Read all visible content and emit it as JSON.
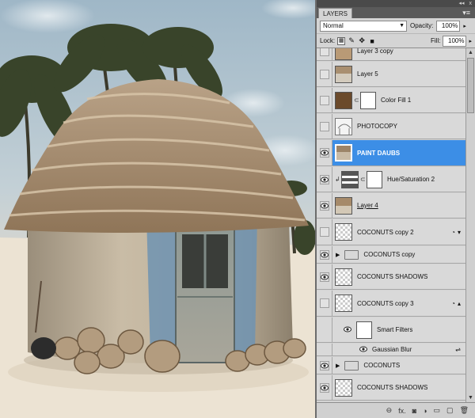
{
  "panel": {
    "title": "LAYERS",
    "window_controls": [
      "◂◂",
      "x"
    ],
    "menu_icon": "panel-menu-icon",
    "blend_mode": "Normal",
    "opacity_label": "Opacity:",
    "opacity_value": "100%",
    "lock_label": "Lock:",
    "fill_label": "Fill:",
    "fill_value": "100%"
  },
  "layers": [
    {
      "name": "Layer 3 copy",
      "visible": false,
      "kind": "image"
    },
    {
      "name": "Layer 5",
      "visible": false,
      "kind": "image"
    },
    {
      "name": "Color Fill 1",
      "visible": false,
      "kind": "fill",
      "color": "#6b4a2b"
    },
    {
      "name": "PHOTOCOPY",
      "visible": false,
      "kind": "sketch"
    },
    {
      "name": "PAINT DAUBS",
      "visible": true,
      "kind": "image",
      "selected": true
    },
    {
      "name": "Hue/Saturation 2",
      "visible": true,
      "kind": "adjustment"
    },
    {
      "name": "Layer 4",
      "visible": true,
      "kind": "image"
    },
    {
      "name": "COCONUTS copy 2",
      "visible": false,
      "kind": "smart"
    },
    {
      "name": "COCONUTS copy",
      "visible": true,
      "kind": "group"
    },
    {
      "name": "COCONUTS SHADOWS",
      "visible": true,
      "kind": "transparent"
    },
    {
      "name": "COCONUTS copy 3",
      "visible": false,
      "kind": "smart"
    },
    {
      "name": "Smart Filters",
      "kind": "smart-filters"
    },
    {
      "name": "Gaussian Blur",
      "kind": "filter"
    },
    {
      "name": "COCONUTS",
      "visible": true,
      "kind": "group"
    },
    {
      "name": "COCONUTS SHADOWS",
      "visible": true,
      "kind": "transparent"
    }
  ],
  "bottom_icons": [
    "link-icon",
    "fx-icon",
    "add-mask-icon",
    "adjustment-icon",
    "new-group-icon",
    "new-layer-icon",
    "trash-icon"
  ],
  "bottom_glyphs": [
    "⊖",
    "fx.",
    "◙",
    "◑",
    "▭",
    "▢",
    "🗑"
  ],
  "colors": {
    "selected": "#3c8ee6",
    "panel": "#d4d4d4"
  }
}
